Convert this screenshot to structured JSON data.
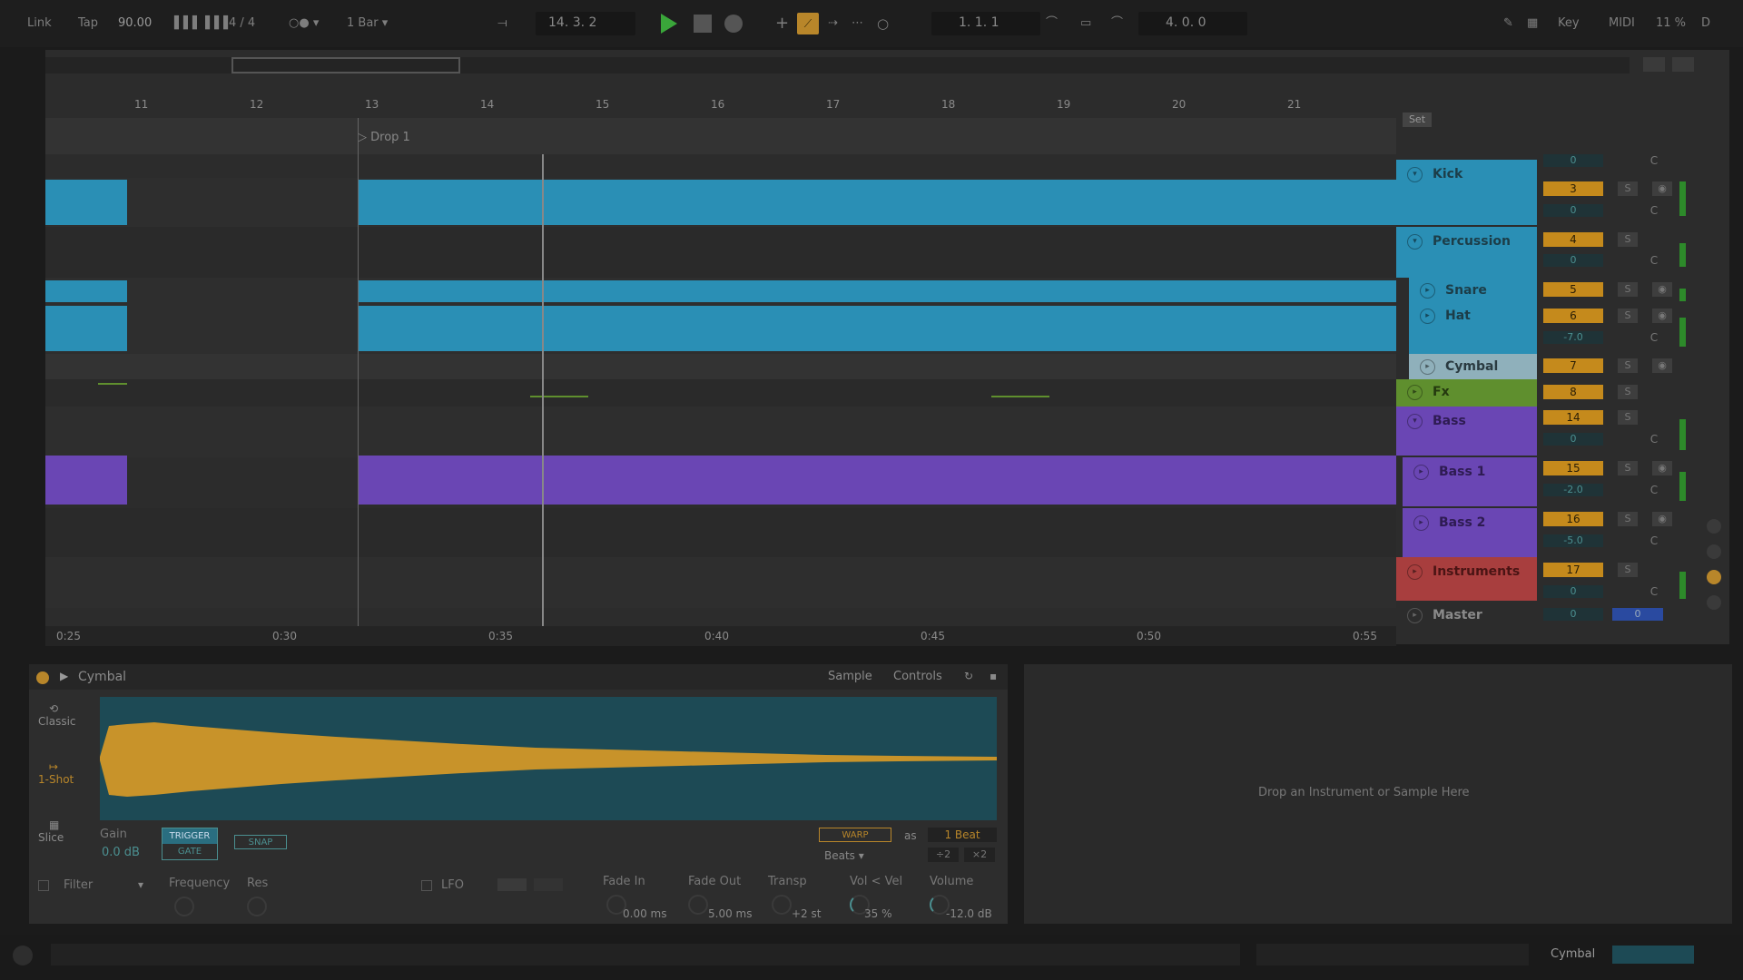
{
  "transport": {
    "link": "Link",
    "tap": "Tap",
    "tempo": "90.00",
    "signature": "4 / 4",
    "quantize": "1 Bar",
    "position": "14.   3.   2",
    "loop_start": "1.   1.   1",
    "loop_length": "4.   0.   0",
    "key": "Key",
    "midi": "MIDI",
    "cpu": "11 %",
    "disk": "D"
  },
  "ruler": {
    "bars": [
      "11",
      "12",
      "13",
      "14",
      "15",
      "16",
      "17",
      "18",
      "19",
      "20",
      "21"
    ],
    "locator": "Drop 1",
    "times": [
      "0:25",
      "0:30",
      "0:35",
      "0:40",
      "0:45",
      "0:50",
      "0:55"
    ]
  },
  "set_label": "Set",
  "tracks": [
    {
      "name": "Kick",
      "color": "#2e9fc7",
      "number": "3",
      "volume": "0",
      "pan": "C",
      "solo": "S"
    },
    {
      "name": "Percussion",
      "color": "#2e9fc7",
      "number": "4",
      "volume": "0",
      "pan": "C",
      "solo": "S"
    },
    {
      "name": "Snare",
      "color": "#2e9fc7",
      "number": "5",
      "volume": "",
      "pan": "",
      "solo": "S"
    },
    {
      "name": "Hat",
      "color": "#2e9fc7",
      "number": "6",
      "volume": "-7.0",
      "pan": "C",
      "solo": "S"
    },
    {
      "name": "Cymbal",
      "color": "#8fb0bb",
      "number": "7",
      "volume": "",
      "pan": "",
      "solo": "S"
    },
    {
      "name": "Fx",
      "color": "#5f8f2e",
      "number": "8",
      "volume": "",
      "pan": "",
      "solo": "S"
    },
    {
      "name": "Bass",
      "color": "#7a4fcf",
      "number": "14",
      "volume": "0",
      "pan": "C",
      "solo": "S"
    },
    {
      "name": "Bass 1",
      "color": "#7a4fcf",
      "number": "15",
      "volume": "-2.0",
      "pan": "C",
      "solo": "S"
    },
    {
      "name": "Bass 2",
      "color": "#7a4fcf",
      "number": "16",
      "volume": "-5.0",
      "pan": "C",
      "solo": "S"
    },
    {
      "name": "Instruments",
      "color": "#c04848",
      "number": "17",
      "volume": "0",
      "pan": "C",
      "solo": "S"
    }
  ],
  "master": {
    "name": "Master",
    "volume": "0",
    "value": "0"
  },
  "device": {
    "name": "Cymbal",
    "tabs": [
      "Sample",
      "Controls"
    ],
    "modes": [
      "Classic",
      "1-Shot",
      "Slice"
    ],
    "gain_label": "Gain",
    "gain_value": "0.0 dB",
    "trigger": "TRIGGER",
    "gate": "GATE",
    "snap": "SNAP",
    "warp": "WARP",
    "as": "as",
    "beats_value": "1 Beat",
    "beats_label": "Beats",
    "half": "÷2",
    "double": "×2",
    "filter": "Filter",
    "frequency": "Frequency",
    "res": "Res",
    "lfo": "LFO",
    "fade_in_label": "Fade In",
    "fade_in_value": "0.00 ms",
    "fade_out_label": "Fade Out",
    "fade_out_value": "5.00 ms",
    "transp_label": "Transp",
    "transp_value": "+2 st",
    "vol_vel_label": "Vol < Vel",
    "vol_vel_value": "35 %",
    "volume_label": "Volume",
    "volume_value": "-12.0 dB"
  },
  "drop_hint": "Drop an Instrument or Sample Here",
  "statusbar": {
    "track": "Cymbal"
  },
  "colors": {
    "blue": "#2e9fc7",
    "purple": "#7a4fcf",
    "green": "#5f8f2e",
    "red": "#c04848",
    "orange": "#c58a1c",
    "waveform": "#c8932a",
    "wave_bg": "#1d4a55"
  }
}
